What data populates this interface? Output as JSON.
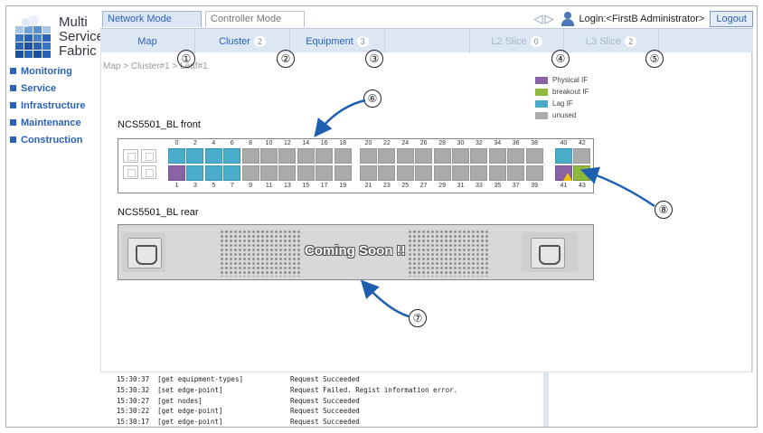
{
  "logo": {
    "line1": "Multi",
    "line2": "Service",
    "line3": "Fabric"
  },
  "menu": [
    {
      "label": "Monitoring"
    },
    {
      "label": "Service"
    },
    {
      "label": "Infrastructure"
    },
    {
      "label": "Maintenance"
    },
    {
      "label": "Construction"
    }
  ],
  "modes": {
    "network": "Network Mode",
    "controller": "Controller Mode"
  },
  "header": {
    "login": "Login:<FirstB Administrator>",
    "logout": "Logout"
  },
  "subtabs": [
    {
      "label": "Map",
      "count": ""
    },
    {
      "label": "Cluster",
      "count": "2"
    },
    {
      "label": "Equipment",
      "count": "3"
    },
    {
      "label": "L2 Slice",
      "count": "0"
    },
    {
      "label": "L3 Slice",
      "count": "2"
    }
  ],
  "callouts": [
    "①",
    "②",
    "③",
    "④",
    "⑤",
    "⑥",
    "⑦",
    "⑧"
  ],
  "breadcrumb": "Map  > Cluster#1 > Leaf#1",
  "legend": [
    {
      "label": "Physical IF",
      "color": "#8a63a7"
    },
    {
      "label": "breakout IF",
      "color": "#8db83c"
    },
    {
      "label": "Lag IF",
      "color": "#4aaccb"
    },
    {
      "label": "unused",
      "color": "#aaaaaa"
    }
  ],
  "front": {
    "title": "NCS5501_BL front",
    "top_ports": [
      "0",
      "2",
      "4",
      "6",
      "8",
      "10",
      "12",
      "14",
      "16",
      "18",
      "20",
      "22",
      "24",
      "26",
      "28",
      "30",
      "32",
      "34",
      "36",
      "38",
      "40",
      "42"
    ],
    "bottom_ports": [
      "1",
      "3",
      "5",
      "7",
      "9",
      "11",
      "13",
      "15",
      "17",
      "19",
      "21",
      "23",
      "25",
      "27",
      "29",
      "31",
      "33",
      "35",
      "37",
      "39",
      "41",
      "43"
    ],
    "top_types": [
      "lag",
      "lag",
      "lag",
      "lag",
      "unused",
      "unused",
      "unused",
      "unused",
      "unused",
      "unused",
      "unused",
      "unused",
      "unused",
      "unused",
      "unused",
      "unused",
      "unused",
      "unused",
      "unused",
      "unused",
      "lag",
      "unused"
    ],
    "bottom_types": [
      "phys",
      "lag",
      "lag",
      "lag",
      "unused",
      "unused",
      "unused",
      "unused",
      "unused",
      "unused",
      "unused",
      "unused",
      "unused",
      "unused",
      "unused",
      "unused",
      "unused",
      "unused",
      "unused",
      "unused",
      "phys",
      "brk"
    ]
  },
  "rear": {
    "title": "NCS5501_BL rear",
    "banner": "Coming Soon !!"
  },
  "log": [
    {
      "time": "15:30:37",
      "cmd": "[get equipment-types]",
      "result": "Request Succeeded"
    },
    {
      "time": "15:30:32",
      "cmd": "[set edge-point]",
      "result": "Request Failed. Regist information error."
    },
    {
      "time": "15:30:27",
      "cmd": "[get nodes]",
      "result": "Request Succeeded"
    },
    {
      "time": "15:30:22",
      "cmd": "[get edge-point]",
      "result": "Request Succeeded"
    },
    {
      "time": "15:30:17",
      "cmd": "[get edge-point]",
      "result": "Request Succeeded"
    }
  ]
}
